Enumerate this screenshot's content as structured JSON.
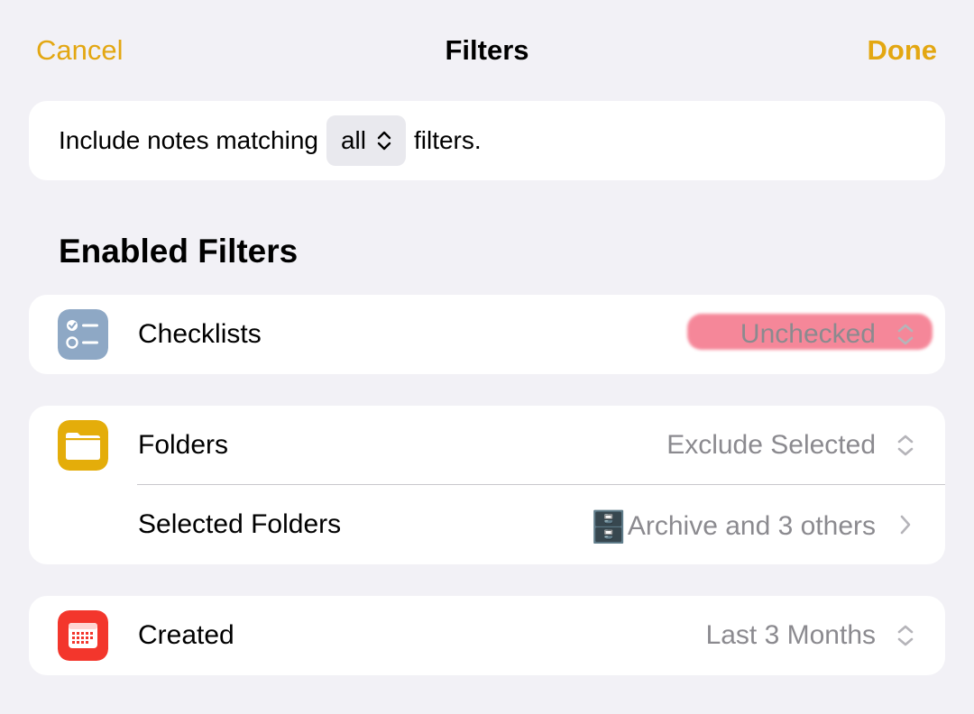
{
  "navbar": {
    "cancel_label": "Cancel",
    "title": "Filters",
    "done_label": "Done"
  },
  "match": {
    "prefix": "Include notes matching",
    "value": "all",
    "suffix": "filters."
  },
  "section": {
    "title": "Enabled Filters"
  },
  "filters": {
    "checklists": {
      "label": "Checklists",
      "value": "Unchecked",
      "icon": "checklist-icon"
    },
    "folders": {
      "label": "Folders",
      "value": "Exclude Selected",
      "icon": "folder-icon"
    },
    "selected_folders": {
      "label": "Selected Folders",
      "emoji": "🗄️",
      "value": "Archive and 3 others"
    },
    "created": {
      "label": "Created",
      "value": "Last 3 Months",
      "icon": "calendar-icon"
    }
  },
  "colors": {
    "accent": "#e3a712",
    "background": "#f2f1f6",
    "secondary_text": "#8b8a8f",
    "checklist_icon_bg": "#8ea8c5",
    "folder_icon_bg": "#e4ad0a",
    "calendar_icon_bg": "#f3362c",
    "highlight": "#f25a73"
  }
}
